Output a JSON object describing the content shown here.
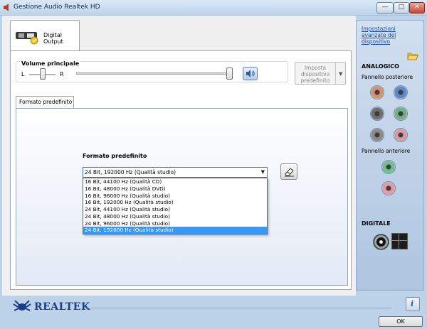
{
  "window": {
    "title": "Gestione Audio Realtek HD",
    "minimize_label": "—",
    "maximize_label": "□",
    "close_label": "✕"
  },
  "device_tab": {
    "label": "Digital Output",
    "icon": "spdif-device-icon"
  },
  "volume": {
    "title": "Volume principale",
    "left_label": "L",
    "right_label": "R",
    "balance": 0.5,
    "level": 1.0
  },
  "default_device_button": {
    "label": "Imposta\ndispositivo\npredefinito"
  },
  "format_tab": {
    "label": "Formato predefinito"
  },
  "format": {
    "title": "Formato predefinito",
    "selected": "24 Bit, 192000 Hz (Qualità studio)",
    "options": [
      "16 Bit, 44100 Hz (Qualità CD)",
      "16 Bit, 48000 Hz (Qualità DVD)",
      "16 Bit, 96000 Hz (Qualità studio)",
      "16 Bit, 192000 Hz (Qualità studio)",
      "24 Bit, 44100 Hz (Qualità studio)",
      "24 Bit, 48000 Hz (Qualità studio)",
      "24 Bit, 96000 Hz (Qualità studio)",
      "24 Bit, 192000 Hz (Qualità studio)"
    ],
    "selected_index": 7
  },
  "side_panel": {
    "advanced_link": "Impostazioni avanzate del dispositivo",
    "analog_title": "ANALOGICO",
    "rear_label": "Pannello posteriore",
    "front_label": "Pannello anteriore",
    "digital_title": "DIGITALE",
    "rear_jack_colors": [
      "#d9906a",
      "#5f86c9",
      "#6f6f6f",
      "#6fb08a",
      "#8a8a8a",
      "#d99aa3"
    ],
    "front_jack_colors": [
      "#6fc08a",
      "#e39aa5"
    ]
  },
  "footer": {
    "brand": "REALTEK",
    "info_label": "i",
    "ok_label": "OK"
  },
  "colors": {
    "link": "#1a4ea8",
    "selection": "#3399ff",
    "brand": "#1b3f86"
  }
}
